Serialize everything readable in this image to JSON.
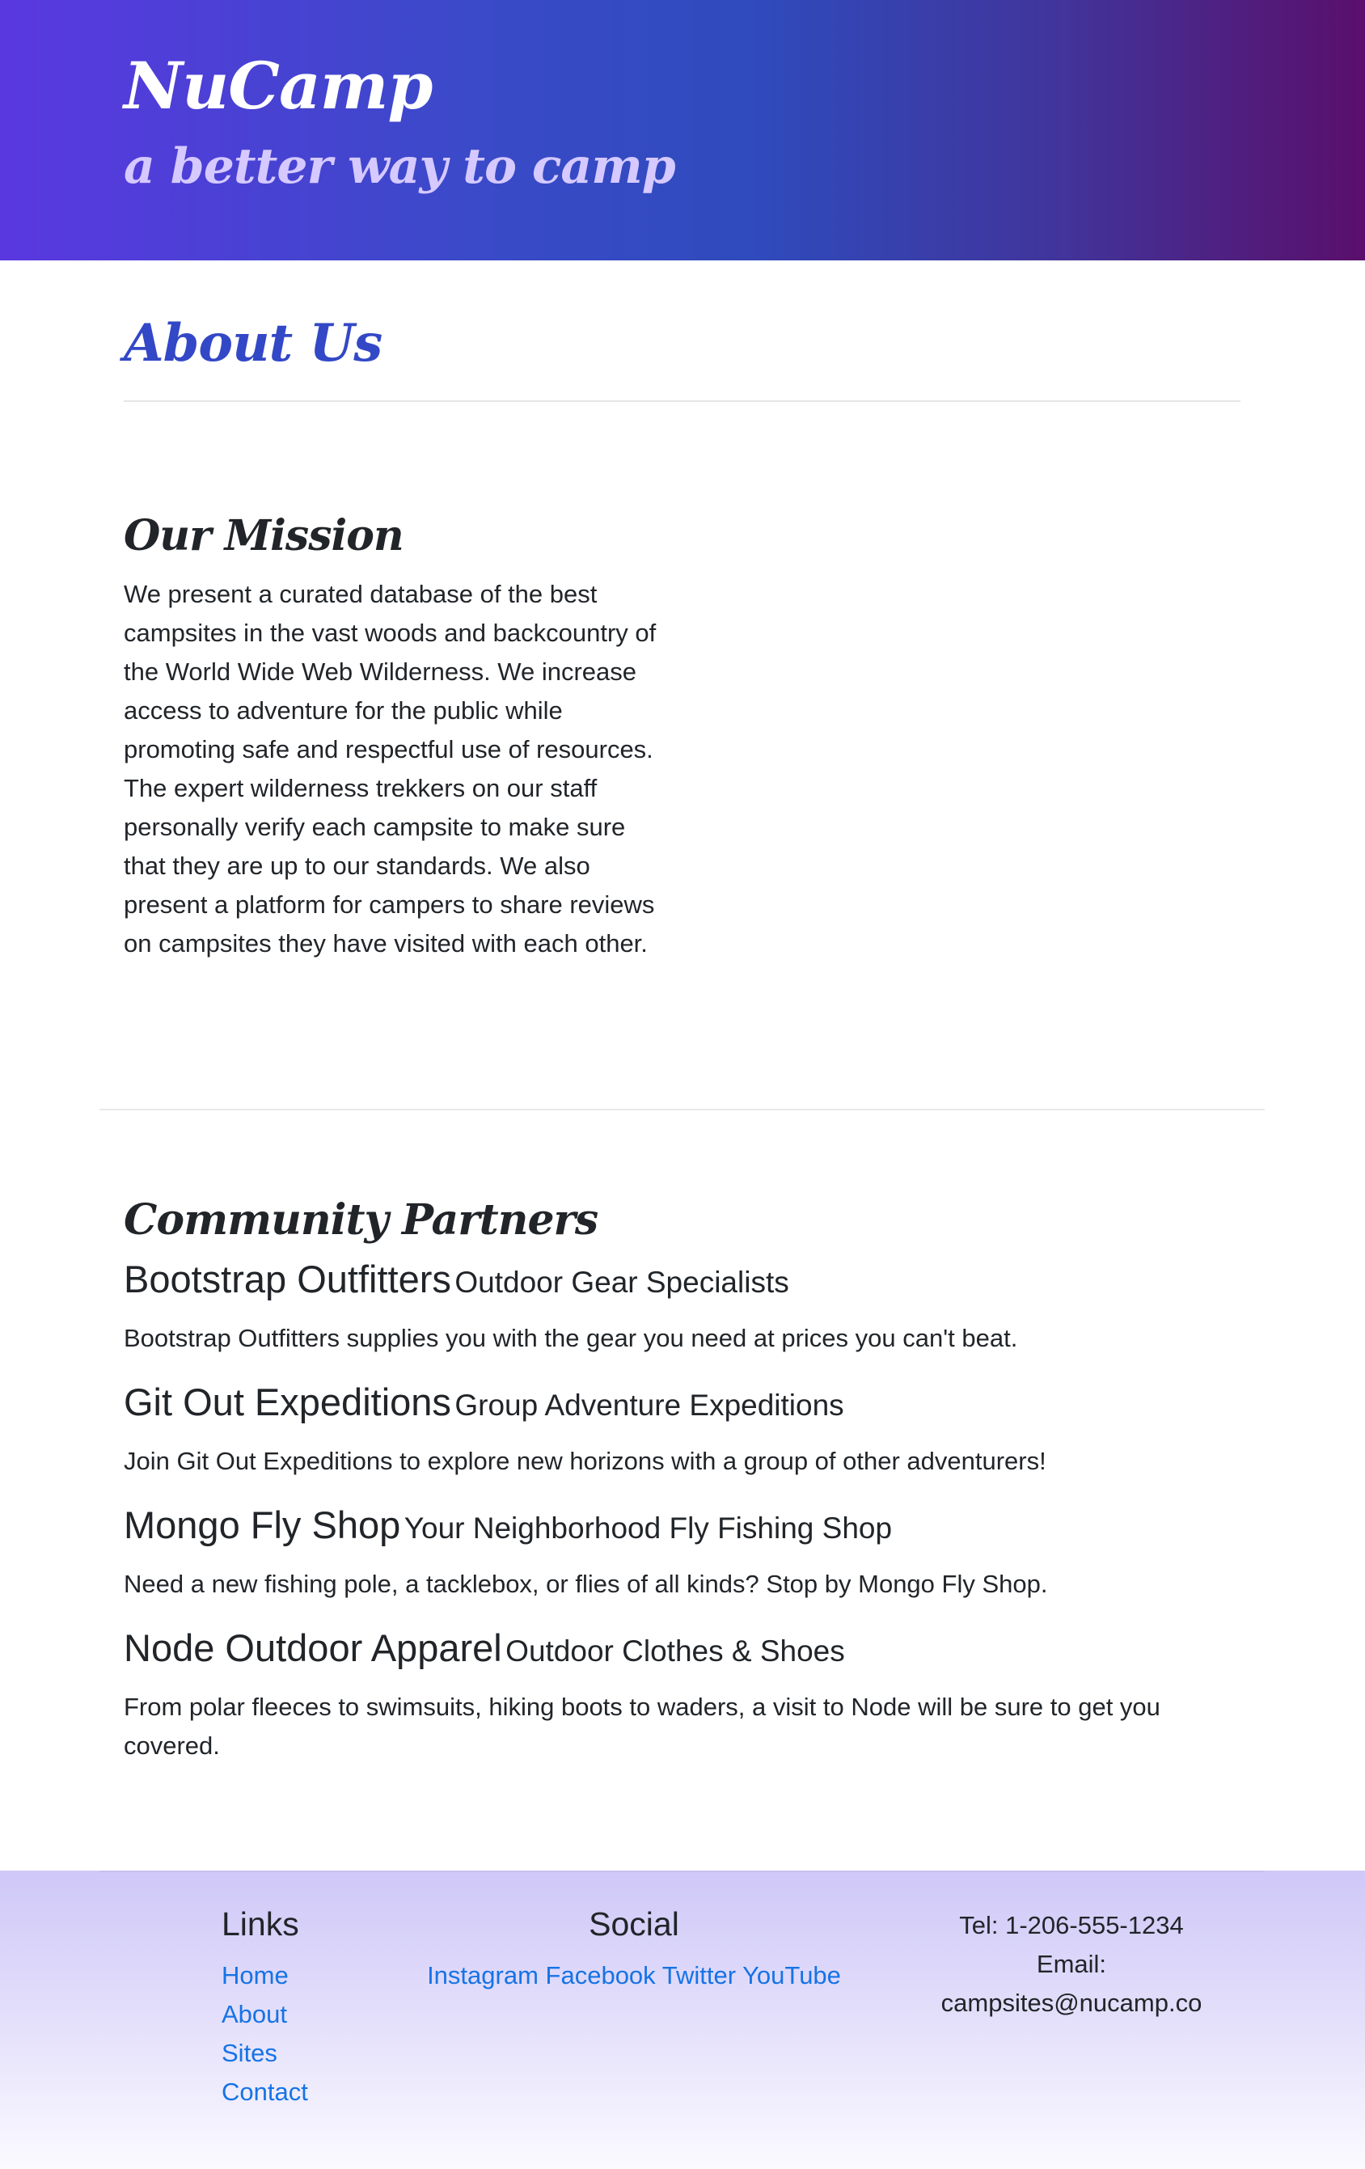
{
  "header": {
    "brand": "NuCamp",
    "tagline": "a better way to camp"
  },
  "main": {
    "page_title": "About Us",
    "mission": {
      "heading": "Our Mission",
      "text": "We present a curated database of the best campsites in the vast woods and backcountry of the World Wide Web Wilderness. We increase access to adventure for the public while promoting safe and respectful use of resources. The expert wilderness trekkers on our staff personally verify each campsite to make sure that they are up to our standards. We also present a platform for campers to share reviews on campsites they have visited with each other."
    },
    "partners": {
      "heading": "Community Partners",
      "items": [
        {
          "name": "Bootstrap Outfitters",
          "tagline": "Outdoor Gear Specialists",
          "description": "Bootstrap Outfitters supplies you with the gear you need at prices you can't beat."
        },
        {
          "name": "Git Out Expeditions",
          "tagline": "Group Adventure Expeditions",
          "description": "Join Git Out Expeditions to explore new horizons with a group of other adventurers!"
        },
        {
          "name": "Mongo Fly Shop",
          "tagline": "Your Neighborhood Fly Fishing Shop",
          "description": "Need a new fishing pole, a tacklebox, or flies of all kinds? Stop by Mongo Fly Shop."
        },
        {
          "name": "Node Outdoor Apparel",
          "tagline": "Outdoor Clothes & Shoes",
          "description": "From polar fleeces to swimsuits, hiking boots to waders, a visit to Node will be sure to get you covered."
        }
      ]
    }
  },
  "footer": {
    "links": {
      "title": "Links",
      "items": [
        "Home",
        "About",
        "Sites",
        "Contact"
      ]
    },
    "social": {
      "title": "Social",
      "items": [
        "Instagram",
        "Facebook",
        "Twitter",
        "YouTube"
      ]
    },
    "contact": {
      "tel": "Tel: 1-206-555-1234",
      "email_label": "Email:",
      "email": "campsites@nucamp.co"
    }
  },
  "colors": {
    "link": "#1673e6",
    "page_title": "#3348c6",
    "tagline": "#d5c9ff"
  }
}
